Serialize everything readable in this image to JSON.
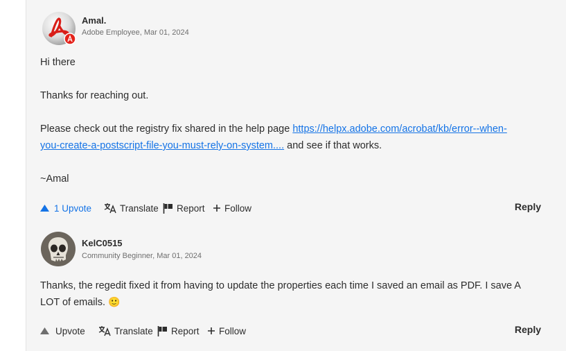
{
  "posts": [
    {
      "author": "Amal.",
      "meta": "Adobe Employee, Mar 01, 2024",
      "greeting": "Hi there",
      "thanks": "Thanks for reaching out.",
      "body_pre": "Please check out the registry fix shared in the help page ",
      "link_line1": "https://helpx.adobe.com/acrobat/kb/error--when-",
      "link_line2": "you-create-a-postscript-file-you-must-rely-on-system....",
      "body_post": " and see if that works.",
      "signoff": "~Amal",
      "upvote": "1 Upvote",
      "translate": "Translate",
      "report": "Report",
      "follow": "Follow",
      "reply": "Reply"
    },
    {
      "author": "KelC0515",
      "meta": "Community Beginner, Mar 01, 2024",
      "line1": "Thanks, the regedit fixed it from having to update the properties each time I saved an email as PDF. I save A",
      "line2": "LOT of emails.",
      "emoji": "🙂",
      "upvote": "Upvote",
      "translate": "Translate",
      "report": "Report",
      "follow": "Follow",
      "reply": "Reply"
    }
  ],
  "colors": {
    "link": "#1473e6",
    "panel": "#f5f5f5",
    "text": "#2c2c2c",
    "meta": "#6e6e6e"
  },
  "icons": [
    "adobe-acrobat-avatar",
    "skull-avatar",
    "upvote-triangle-icon",
    "translate-icon",
    "flag-icon",
    "plus-icon",
    "smile-emoji"
  ]
}
